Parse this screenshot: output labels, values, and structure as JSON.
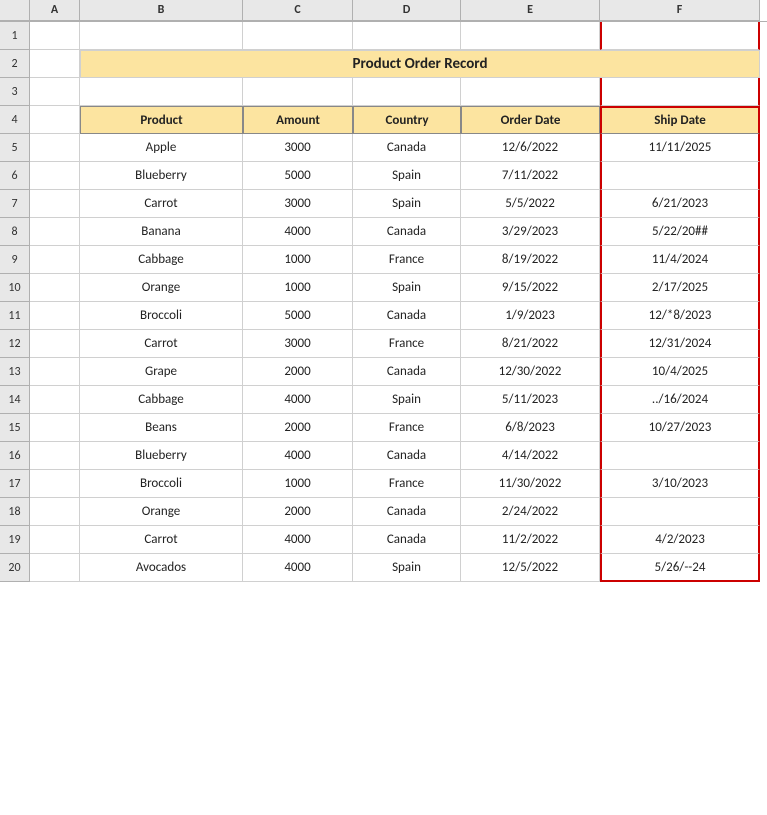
{
  "title": "Product Order Record",
  "columns": {
    "a": "A",
    "b": "B",
    "c": "C",
    "d": "D",
    "e": "E",
    "f": "F"
  },
  "headers": {
    "product": "Product",
    "amount": "Amount",
    "country": "Country",
    "orderDate": "Order Date",
    "shipDate": "Ship Date"
  },
  "rows": [
    {
      "num": 1,
      "product": "",
      "amount": "",
      "country": "",
      "orderDate": "",
      "shipDate": ""
    },
    {
      "num": 2,
      "product": "",
      "amount": "",
      "country": "",
      "orderDate": "",
      "shipDate": ""
    },
    {
      "num": 3,
      "product": "",
      "amount": "",
      "country": "",
      "orderDate": "",
      "shipDate": ""
    },
    {
      "num": 4,
      "product": "Product",
      "amount": "Amount",
      "country": "Country",
      "orderDate": "Order Date",
      "shipDate": "Ship Date",
      "isHeader": true
    },
    {
      "num": 5,
      "product": "Apple",
      "amount": "3000",
      "country": "Canada",
      "orderDate": "12/6/2022",
      "shipDate": "11/11/2025"
    },
    {
      "num": 6,
      "product": "Blueberry",
      "amount": "5000",
      "country": "Spain",
      "orderDate": "7/11/2022",
      "shipDate": ""
    },
    {
      "num": 7,
      "product": "Carrot",
      "amount": "3000",
      "country": "Spain",
      "orderDate": "5/5/2022",
      "shipDate": "6/21/2023"
    },
    {
      "num": 8,
      "product": "Banana",
      "amount": "4000",
      "country": "Canada",
      "orderDate": "3/29/2023",
      "shipDate": "5/22/20##"
    },
    {
      "num": 9,
      "product": "Cabbage",
      "amount": "1000",
      "country": "France",
      "orderDate": "8/19/2022",
      "shipDate": "11/4/2024"
    },
    {
      "num": 10,
      "product": "Orange",
      "amount": "1000",
      "country": "Spain",
      "orderDate": "9/15/2022",
      "shipDate": "2/17/2025"
    },
    {
      "num": 11,
      "product": "Broccoli",
      "amount": "5000",
      "country": "Canada",
      "orderDate": "1/9/2023",
      "shipDate": "12/*8/2023"
    },
    {
      "num": 12,
      "product": "Carrot",
      "amount": "3000",
      "country": "France",
      "orderDate": "8/21/2022",
      "shipDate": "12/31/2024"
    },
    {
      "num": 13,
      "product": "Grape",
      "amount": "2000",
      "country": "Canada",
      "orderDate": "12/30/2022",
      "shipDate": "10/4/2025"
    },
    {
      "num": 14,
      "product": "Cabbage",
      "amount": "4000",
      "country": "Spain",
      "orderDate": "5/11/2023",
      "shipDate": "../16/2024"
    },
    {
      "num": 15,
      "product": "Beans",
      "amount": "2000",
      "country": "France",
      "orderDate": "6/8/2023",
      "shipDate": "10/27/2023"
    },
    {
      "num": 16,
      "product": "Blueberry",
      "amount": "4000",
      "country": "Canada",
      "orderDate": "4/14/2022",
      "shipDate": ""
    },
    {
      "num": 17,
      "product": "Broccoli",
      "amount": "1000",
      "country": "France",
      "orderDate": "11/30/2022",
      "shipDate": "3/10/2023"
    },
    {
      "num": 18,
      "product": "Orange",
      "amount": "2000",
      "country": "Canada",
      "orderDate": "2/24/2022",
      "shipDate": ""
    },
    {
      "num": 19,
      "product": "Carrot",
      "amount": "4000",
      "country": "Canada",
      "orderDate": "11/2/2022",
      "shipDate": "4/2/2023"
    },
    {
      "num": 20,
      "product": "Avocados",
      "amount": "4000",
      "country": "Spain",
      "orderDate": "12/5/2022",
      "shipDate": "5/26/--24"
    }
  ]
}
